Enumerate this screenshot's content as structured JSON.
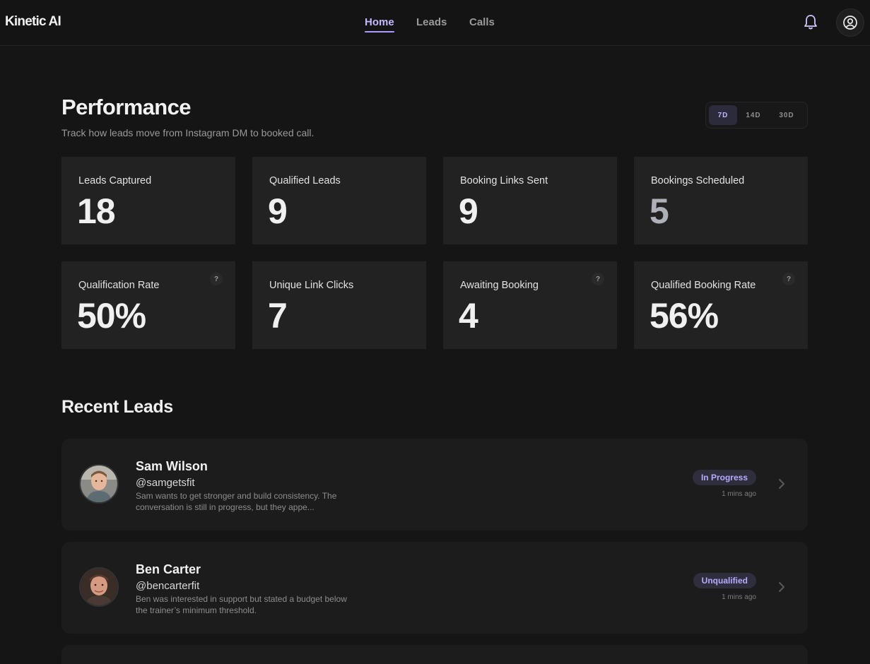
{
  "header": {
    "brand": "Kinetic AI",
    "nav": [
      {
        "label": "Home",
        "active": true
      },
      {
        "label": "Leads",
        "active": false
      },
      {
        "label": "Calls",
        "active": false
      }
    ],
    "icons": {
      "notifications": "bell-icon",
      "account": "user-circle-icon"
    }
  },
  "performance": {
    "title": "Performance",
    "subtitle": "Track how leads move from Instagram DM to booked call.",
    "ranges": [
      {
        "label": "7D",
        "active": true
      },
      {
        "label": "14D",
        "active": false
      },
      {
        "label": "30D",
        "active": false
      }
    ],
    "metrics": [
      {
        "label": "Leads Captured",
        "value": "18",
        "help": false
      },
      {
        "label": "Qualified Leads",
        "value": "9",
        "help": false
      },
      {
        "label": "Booking Links Sent",
        "value": "9",
        "help": false
      },
      {
        "label": "Bookings Scheduled",
        "value": "5",
        "help": false
      },
      {
        "label": "Qualification Rate",
        "value": "50%",
        "help": true
      },
      {
        "label": "Unique Link Clicks",
        "value": "7",
        "help": false
      },
      {
        "label": "Awaiting Booking",
        "value": "4",
        "help": true
      },
      {
        "label": "Qualified Booking Rate",
        "value": "56%",
        "help": true
      }
    ],
    "help_glyph": "?"
  },
  "recent_leads": {
    "title": "Recent Leads",
    "items": [
      {
        "name": "Sam Wilson",
        "handle": "@samgetsfit",
        "summary": "Sam wants to get stronger and build consistency. The conversation is still in progress, but they appe...",
        "status": "In Progress",
        "time": "1 mins ago"
      },
      {
        "name": "Ben Carter",
        "handle": "@bencarterfit",
        "summary": "Ben was interested in support but stated a budget below the trainer’s minimum threshold.",
        "status": "Unqualified",
        "time": "1 mins ago"
      }
    ]
  },
  "colors": {
    "background": "#151515",
    "card": "#222222",
    "accent": "#a99bff",
    "badge_bg": "#2e2e3c"
  }
}
